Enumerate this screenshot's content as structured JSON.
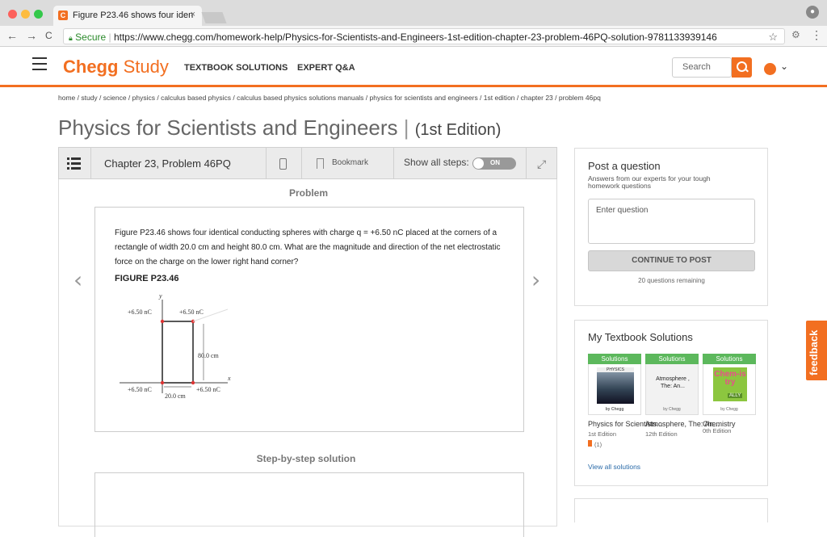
{
  "browser": {
    "tab_title": "Figure P23.46 shows four iden",
    "tab_close": "×",
    "favicon": "C",
    "secure_label": "Secure",
    "url": "https://www.chegg.com/homework-help/Physics-for-Scientists-and-Engineers-1st-edition-chapter-23-problem-46PQ-solution-9781133939146",
    "nav_back": "←",
    "nav_forward": "→",
    "nav_reload": "C",
    "star": "☆",
    "menu": "⋮"
  },
  "header": {
    "logo_main": "Chegg",
    "logo_sub": "Study",
    "nav_links": [
      "TEXTBOOK SOLUTIONS",
      "EXPERT Q&A"
    ],
    "search_placeholder": "Search",
    "accent_color": "#f26f21"
  },
  "breadcrumb": "home / study / science / physics / calculus based physics / calculus based physics solutions manuals / physics for scientists and engineers / 1st edition / chapter 23 / problem 46pq",
  "book": {
    "title": "Physics for Scientists and Engineers",
    "edition": "(1st Edition)"
  },
  "toolbar": {
    "chapter_label": "Chapter 23, Problem 46PQ",
    "bookmark_label": "Bookmark",
    "show_all_label": "Show all steps:",
    "toggle_state": "ON"
  },
  "problem": {
    "heading": "Problem",
    "text": "Figure P23.46 shows four identical conducting spheres with charge q = +6.50 nC placed at the corners of a rectangle of width 20.0 cm and height 80.0 cm. What are the magnitude and direction of the net electrostatic force on the charge on the lower right hand corner?",
    "figure_label": "FIGURE P23.46",
    "figure": {
      "axis_y": "y",
      "axis_x": "x",
      "charge_top_left": "+6.50 nC",
      "charge_top_right": "+6.50 nC",
      "charge_bottom_left": "+6.50 nC",
      "charge_bottom_right": "+6.50 nC",
      "height_label": "80.0 cm",
      "width_label": "20.0 cm"
    }
  },
  "solution": {
    "heading": "Step-by-step solution",
    "prev_arrow": "‹",
    "next_arrow": "›"
  },
  "post_question": {
    "title": "Post a question",
    "subtitle": "Answers from our experts for your tough homework questions",
    "placeholder": "Enter question",
    "button": "CONTINUE TO POST",
    "remaining": "20 questions remaining"
  },
  "textbooks": {
    "title": "My Textbook Solutions",
    "items": [
      {
        "ribbon": "Solutions",
        "cover_brand": "PHYSICS",
        "cover_by": "by Chegg",
        "name": "Physics for Scientists...",
        "edition": "1st Edition",
        "badge": "(1)"
      },
      {
        "ribbon": "Solutions",
        "cover_text": "Atmosphere , The: An...",
        "cover_by": "by Chegg",
        "name": "Atmosphere, The: An...",
        "edition": "12th Edition"
      },
      {
        "ribbon": "Solutions",
        "cover_text": "Chem-istry",
        "cover_badge": "ALLY",
        "cover_by": "by Chegg",
        "name": "Chemistry",
        "edition": "0th Edition"
      }
    ],
    "view_all": "View all solutions"
  },
  "feedback": "feedback"
}
